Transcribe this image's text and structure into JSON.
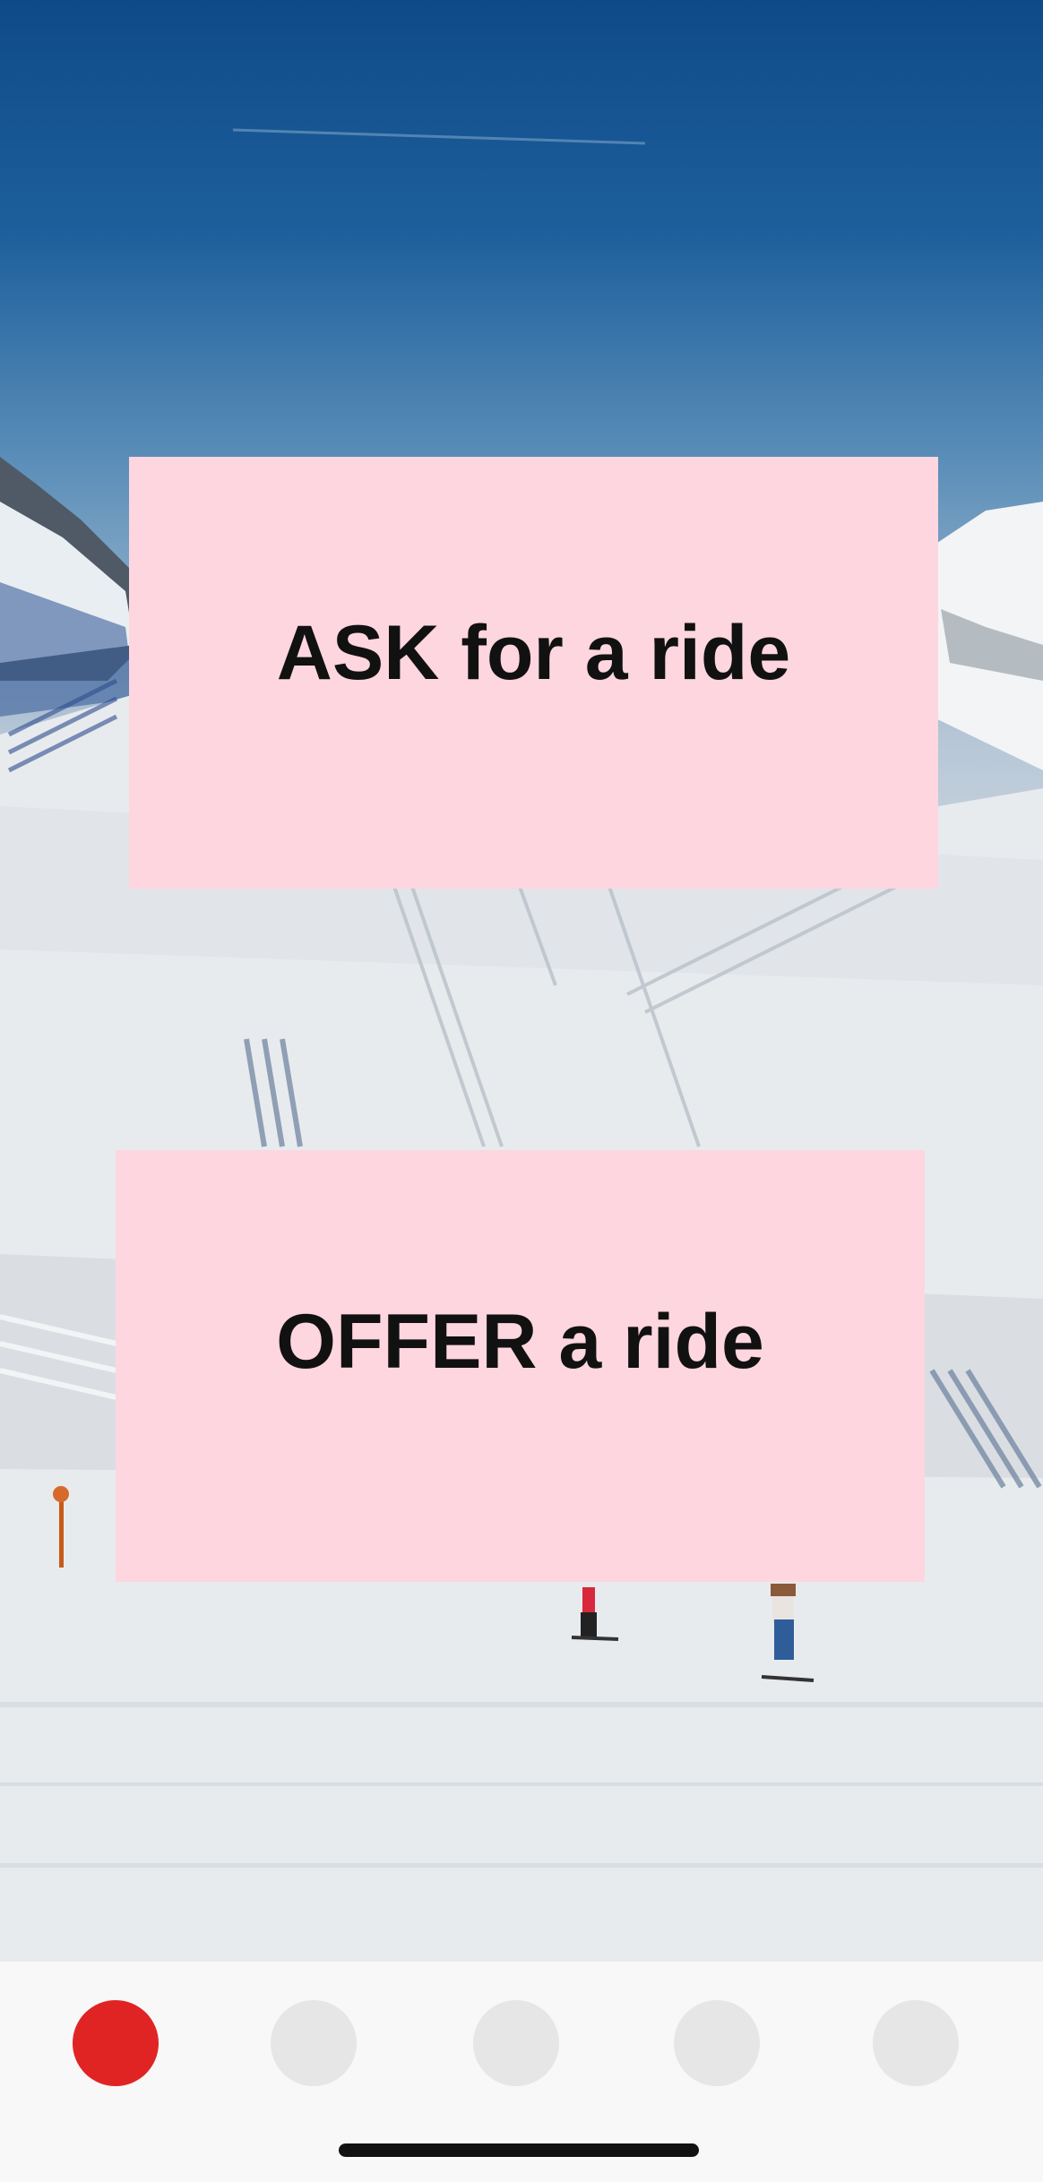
{
  "screen": {
    "background_scene": "ski slope with mountains and skiers"
  },
  "actions": {
    "ask_label": "ASK for a ride",
    "offer_label": "OFFER a ride"
  },
  "tabbar": {
    "active_index": 0,
    "tabs": [
      {
        "name": "tab-1",
        "active": true
      },
      {
        "name": "tab-2",
        "active": false
      },
      {
        "name": "tab-3",
        "active": false
      },
      {
        "name": "tab-4",
        "active": false
      },
      {
        "name": "tab-5",
        "active": false
      }
    ]
  },
  "colors": {
    "button_bg": "#fdd6df",
    "active_tab": "#e02424",
    "inactive_tab": "#e6e6e6",
    "tabbar_bg": "#f8f8f8"
  }
}
